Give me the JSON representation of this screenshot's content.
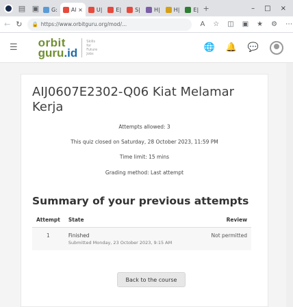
{
  "browser": {
    "tabs": [
      {
        "label": "G:",
        "favicon_color": "#5b9bd5"
      },
      {
        "label": "Al ×",
        "favicon_color": "#e64a3c",
        "active": true
      },
      {
        "label": "U|",
        "favicon_color": "#e64a3c"
      },
      {
        "label": "E|",
        "favicon_color": "#e64a3c"
      },
      {
        "label": "S|",
        "favicon_color": "#e64a3c"
      },
      {
        "label": "H|",
        "favicon_color": "#7b5ea7"
      },
      {
        "label": "H|",
        "favicon_color": "#d4a017"
      },
      {
        "label": "E|",
        "favicon_color": "#2e7d32"
      }
    ],
    "new_tab": "+",
    "url": "https://www.orbitguru.org/mod/...",
    "window_controls": [
      "–",
      "□",
      "×"
    ]
  },
  "site": {
    "logo_line1": "orbit",
    "logo_line2": "guru",
    "logo_suffix": ".id",
    "tagline": [
      "Skills",
      "for",
      "Future",
      "Jobs"
    ]
  },
  "quiz": {
    "title": "AIJ0607E2302-Q06 Kiat Melamar Kerja",
    "attempts_allowed": "Attempts allowed: 3",
    "closed_on": "This quiz closed on Saturday, 28 October 2023, 11:59 PM",
    "time_limit": "Time limit: 15 mins",
    "grading_method": "Grading method: Last attempt"
  },
  "summary": {
    "heading": "Summary of your previous attempts",
    "columns": [
      "Attempt",
      "State",
      "Review"
    ],
    "rows": [
      {
        "attempt": "1",
        "state": "Finished",
        "submitted": "Submitted Monday, 23 October 2023, 9:15 AM",
        "review": "Not permitted"
      }
    ]
  },
  "actions": {
    "back_label": "Back to the course"
  },
  "colors": {
    "logo_green": "#6f8f2f",
    "logo_blue": "#1e6ca8",
    "globe_blue": "#3a7bd5"
  }
}
